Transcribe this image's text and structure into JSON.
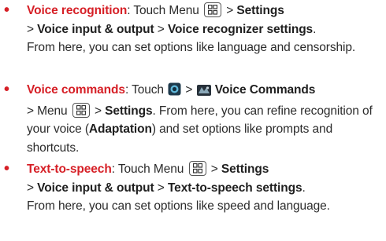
{
  "items": [
    {
      "title": "Voice recognition",
      "sep": ": Touch Menu",
      "gt1": ">",
      "settings": "Settings",
      "line2_gt": ">",
      "voice_io": "Voice input & output",
      "gt2": ">",
      "target": "Voice recognizer settings",
      "period": ".",
      "desc": "From here, you can set options like language and censorship."
    },
    {
      "title": "Voice commands",
      "sep": ": Touch",
      "gt1": ">",
      "app": "Voice Commands",
      "line2_a": "> Menu",
      "gt2": ">",
      "settings": "Settings",
      "desc_a": ". From here, you can refine recognition of your voice (",
      "adaptation": "Adaptation",
      "desc_b": ") and set options like prompts and shortcuts."
    },
    {
      "title": "Text-to-speech",
      "sep": ": Touch Menu",
      "gt1": ">",
      "settings": "Settings",
      "line2_gt": ">",
      "voice_io": "Voice input & output",
      "gt2": ">",
      "target": "Text-to-speech settings",
      "period": ".",
      "desc": "From here, you can set options like speed and language."
    }
  ],
  "icons": {
    "menu_key": "menu-key-icon",
    "voice_dialer": "voice-app-icon",
    "voice_commands": "voice-commands-icon"
  },
  "colors": {
    "accent": "#d61f26",
    "text": "#2b2b2b"
  }
}
